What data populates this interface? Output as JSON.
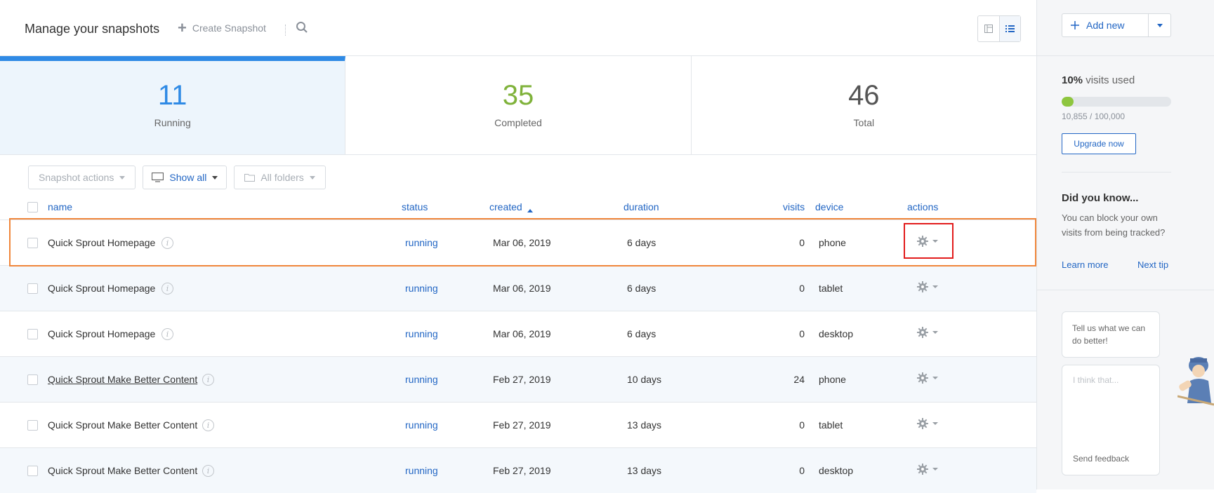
{
  "header": {
    "title": "Manage your snapshots",
    "create_label": "Create Snapshot"
  },
  "stats": [
    {
      "value": "11",
      "label": "Running",
      "color": "#2f8ae5"
    },
    {
      "value": "35",
      "label": "Completed",
      "color": "#7fb23a"
    },
    {
      "value": "46",
      "label": "Total",
      "color": "#555555"
    }
  ],
  "filters": {
    "snapshot_actions": "Snapshot actions",
    "show_all": "Show all",
    "all_folders": "All folders"
  },
  "table": {
    "columns": {
      "name": "name",
      "status": "status",
      "created": "created",
      "duration": "duration",
      "visits": "visits",
      "device": "device",
      "actions": "actions"
    },
    "rows": [
      {
        "name": "Quick Sprout Homepage",
        "status": "running",
        "created": "Mar 06, 2019",
        "duration": "6 days",
        "visits": "0",
        "device": "phone"
      },
      {
        "name": "Quick Sprout Homepage",
        "status": "running",
        "created": "Mar 06, 2019",
        "duration": "6 days",
        "visits": "0",
        "device": "tablet"
      },
      {
        "name": "Quick Sprout Homepage",
        "status": "running",
        "created": "Mar 06, 2019",
        "duration": "6 days",
        "visits": "0",
        "device": "desktop"
      },
      {
        "name": "Quick Sprout Make Better Content",
        "status": "running",
        "created": "Feb 27, 2019",
        "duration": "10 days",
        "visits": "24",
        "device": "phone"
      },
      {
        "name": "Quick Sprout Make Better Content",
        "status": "running",
        "created": "Feb 27, 2019",
        "duration": "13 days",
        "visits": "0",
        "device": "tablet"
      },
      {
        "name": "Quick Sprout Make Better Content",
        "status": "running",
        "created": "Feb 27, 2019",
        "duration": "13 days",
        "visits": "0",
        "device": "desktop"
      }
    ]
  },
  "sidebar": {
    "add_new": "Add new",
    "visits_percent": "10%",
    "visits_used_label": "visits used",
    "visits_fraction": 0.10855,
    "visits_count": "10,855 / 100,000",
    "upgrade": "Upgrade now",
    "tip_title": "Did you know...",
    "tip_text": "You can block your own visits from being tracked?",
    "learn_more": "Learn more",
    "next_tip": "Next tip",
    "bubble_text": "Tell us what we can do better!",
    "feedback_placeholder": "I think that...",
    "send_feedback": "Send feedback"
  }
}
